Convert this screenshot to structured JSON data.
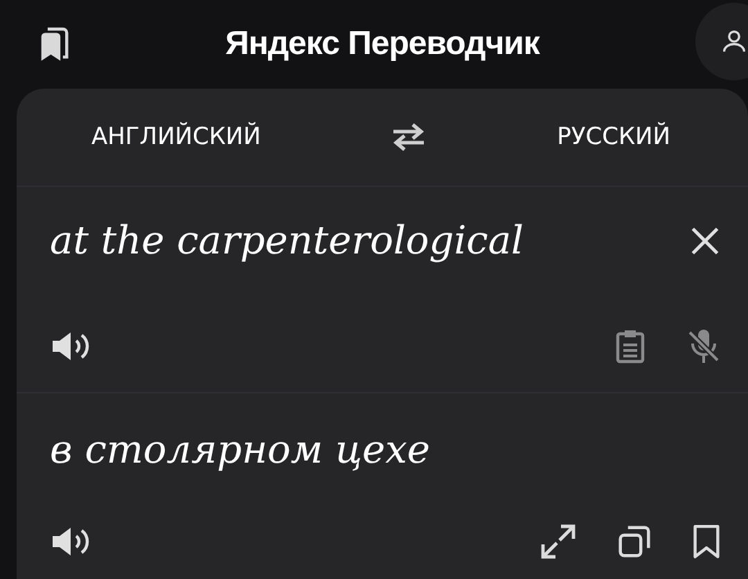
{
  "header": {
    "title": "Яндекс Переводчик"
  },
  "languages": {
    "source": "АНГЛИЙСКИЙ",
    "target": "РУССКИЙ"
  },
  "input": {
    "value": "at the carpenterological"
  },
  "output": {
    "text": "в столярном цехе"
  }
}
